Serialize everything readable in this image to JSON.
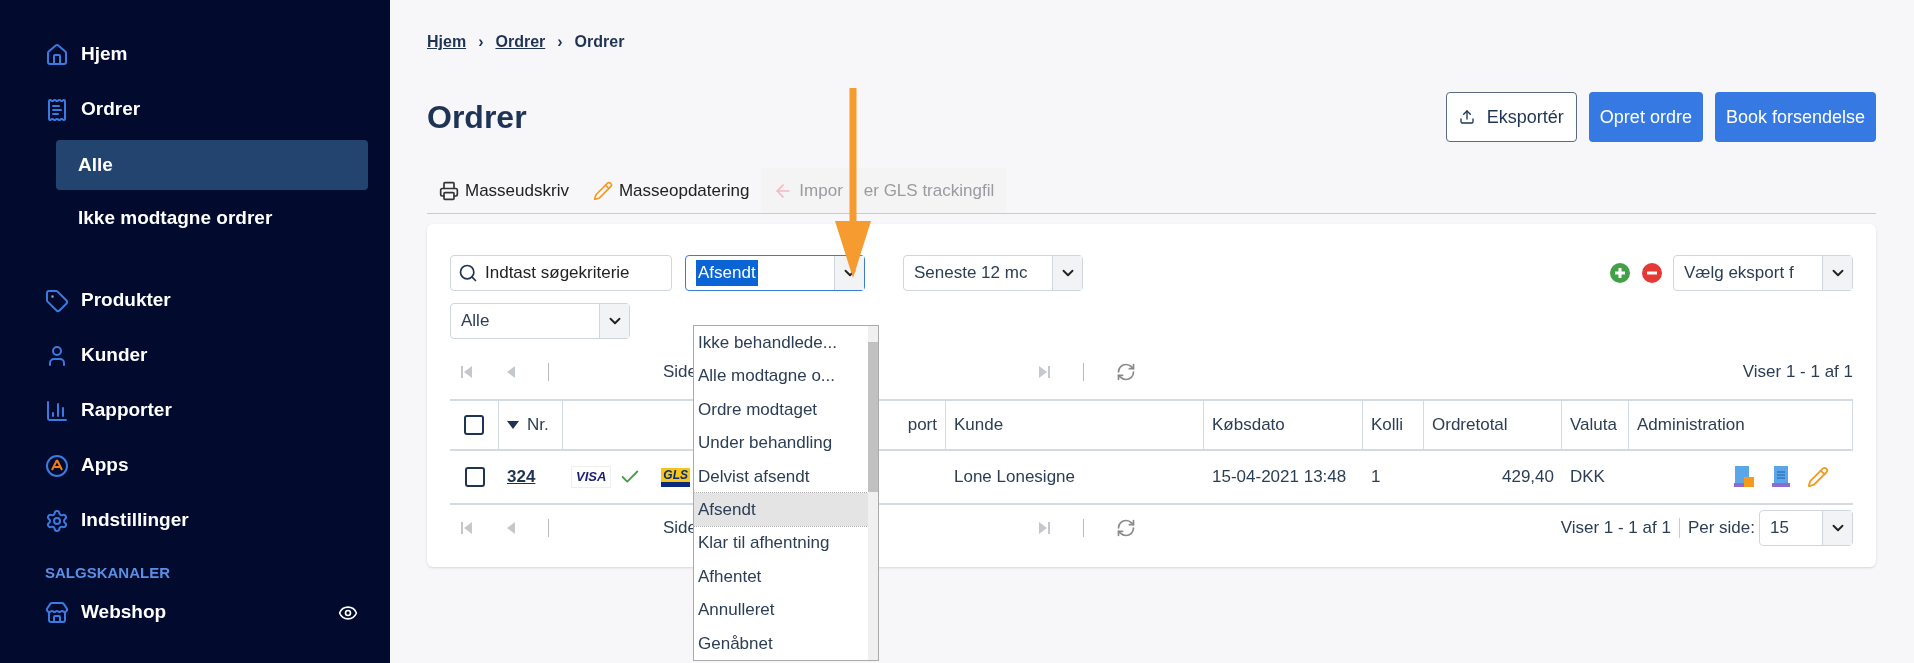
{
  "sidebar": {
    "items": [
      {
        "label": "Hjem",
        "selected": false
      },
      {
        "label": "Ordrer",
        "selected": false,
        "children": [
          {
            "label": "Alle",
            "selected": true
          },
          {
            "label": "Ikke modtagne ordrer",
            "selected": false
          }
        ]
      },
      {
        "label": "Produkter",
        "selected": false
      },
      {
        "label": "Kunder",
        "selected": false
      },
      {
        "label": "Rapporter",
        "selected": false
      },
      {
        "label": "Apps",
        "selected": false
      },
      {
        "label": "Indstillinger",
        "selected": false
      }
    ],
    "section_label": "SALGSKANALER",
    "channels": [
      {
        "label": "Webshop"
      }
    ]
  },
  "breadcrumb": [
    {
      "label": "Hjem",
      "kind": "link"
    },
    {
      "label": "›",
      "kind": "separator"
    },
    {
      "label": "Ordrer",
      "kind": "link"
    },
    {
      "label": "›",
      "kind": "separator"
    },
    {
      "label": "Ordrer",
      "kind": "current"
    }
  ],
  "page_title": "Ordrer",
  "header_buttons": [
    {
      "label": "Eksportér",
      "kind": "outline"
    },
    {
      "label": "Opret ordre",
      "kind": "primary"
    },
    {
      "label": "Book forsendelse",
      "kind": "primary"
    }
  ],
  "toolbar": [
    {
      "label": "Masseudskriv",
      "disabled": false
    },
    {
      "label": "Masseopdatering",
      "disabled": false
    },
    {
      "label_parts": [
        "Impor",
        "er GLS trackingfil"
      ],
      "disabled": true
    }
  ],
  "filters": {
    "search_placeholder": "Indtast søgekriterie",
    "status_value": "Afsendt",
    "period_value": "Seneste 12 mc",
    "group_value": "Alle",
    "export_value": "Vælg eksport f"
  },
  "status_options": [
    {
      "label": "Ikke behandlede...",
      "selected": false
    },
    {
      "label": "Alle modtagne o...",
      "selected": false
    },
    {
      "label": "Ordre modtaget",
      "selected": false
    },
    {
      "label": "Under behandling",
      "selected": false
    },
    {
      "label": "Delvist afsendt",
      "selected": false
    },
    {
      "label": "Afsendt",
      "selected": true
    },
    {
      "label": "Klar til afhentning",
      "selected": false
    },
    {
      "label": "Afhentet",
      "selected": false
    },
    {
      "label": "Annulleret",
      "selected": false
    },
    {
      "label": "Genåbnet",
      "selected": false
    }
  ],
  "pager_top": {
    "page_label": "Side",
    "summary": "Viser 1 - 1 af 1"
  },
  "pager_bottom": {
    "page_label": "Side",
    "summary": "Viser 1 - 1 af 1",
    "per_page_label": "Per side:",
    "per_page_value": "15"
  },
  "table": {
    "columns": [
      "Nr.",
      "",
      "port",
      "Kunde",
      "Købsdato",
      "Kolli",
      "Ordretotal",
      "Valuta",
      "Administration"
    ],
    "rows": [
      {
        "checked": false,
        "number": "324",
        "card": "VISA",
        "paid": true,
        "carrier": "GLS",
        "customer": "Lone Lonesigne",
        "date": "15-04-2021 13:48",
        "parcels": "1",
        "total": "429,40",
        "currency": "DKK"
      }
    ],
    "header_checked": false
  }
}
